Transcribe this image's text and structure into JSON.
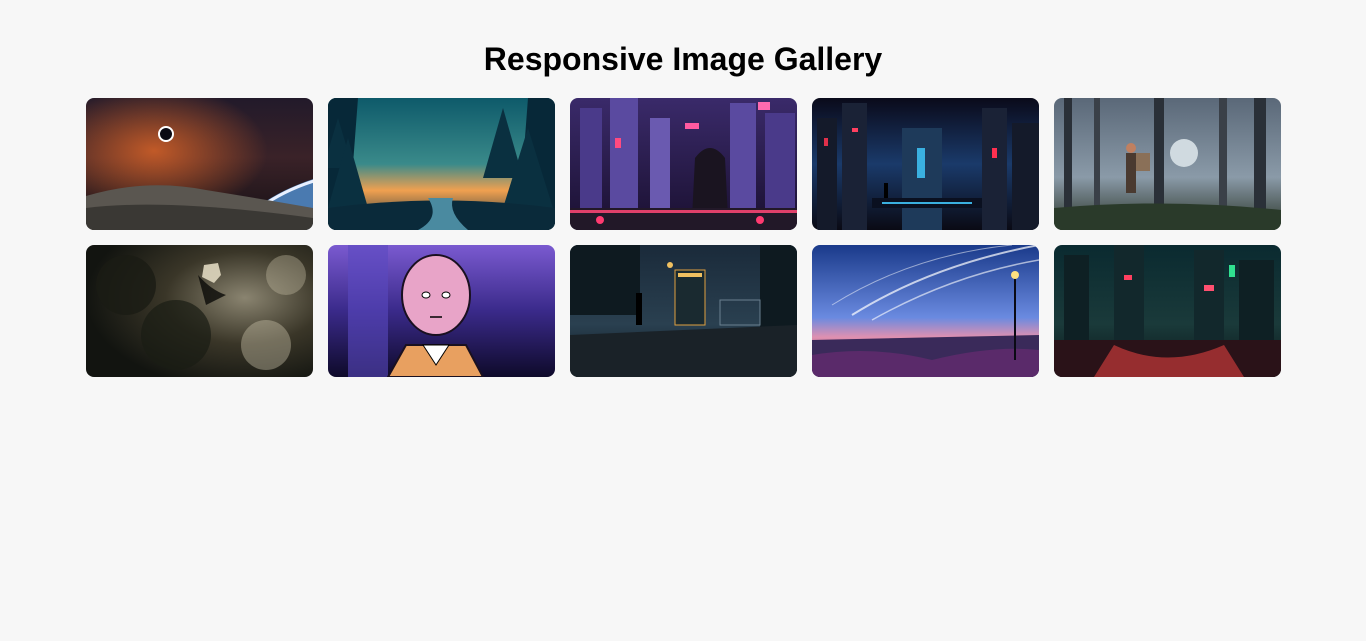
{
  "page": {
    "title": "Responsive Image Gallery"
  },
  "gallery": {
    "images": [
      {
        "name": "space-planet",
        "palette": [
          "#1a1420",
          "#7a2a1a",
          "#c05a20"
        ]
      },
      {
        "name": "forest-river-sunset",
        "palette": [
          "#0d4a5a",
          "#f0a050",
          "#0a2a3a"
        ]
      },
      {
        "name": "neon-city-hooded-figure",
        "palette": [
          "#2a1a4a",
          "#6a4ac0",
          "#e0406a"
        ]
      },
      {
        "name": "cyberpunk-city-skyline",
        "palette": [
          "#0a0a1a",
          "#1a3a6a",
          "#e0304a"
        ]
      },
      {
        "name": "misty-forest-warrior",
        "palette": [
          "#3a4250",
          "#8a9aa8",
          "#2a3a2a"
        ]
      },
      {
        "name": "dark-foliage-shadow",
        "palette": [
          "#1a1a14",
          "#5a5448",
          "#b0a890"
        ]
      },
      {
        "name": "bald-hero-portrait",
        "palette": [
          "#2a1a5a",
          "#7a5ad0",
          "#e0a0c0"
        ]
      },
      {
        "name": "night-street-bus-stop",
        "palette": [
          "#0a1620",
          "#2a4050",
          "#e0a040"
        ]
      },
      {
        "name": "starry-sky-city-view",
        "palette": [
          "#1a3a8a",
          "#6a8ae0",
          "#c060a0"
        ]
      },
      {
        "name": "rainy-neon-street",
        "palette": [
          "#0a1a20",
          "#1a3a3a",
          "#e04040"
        ]
      }
    ]
  }
}
